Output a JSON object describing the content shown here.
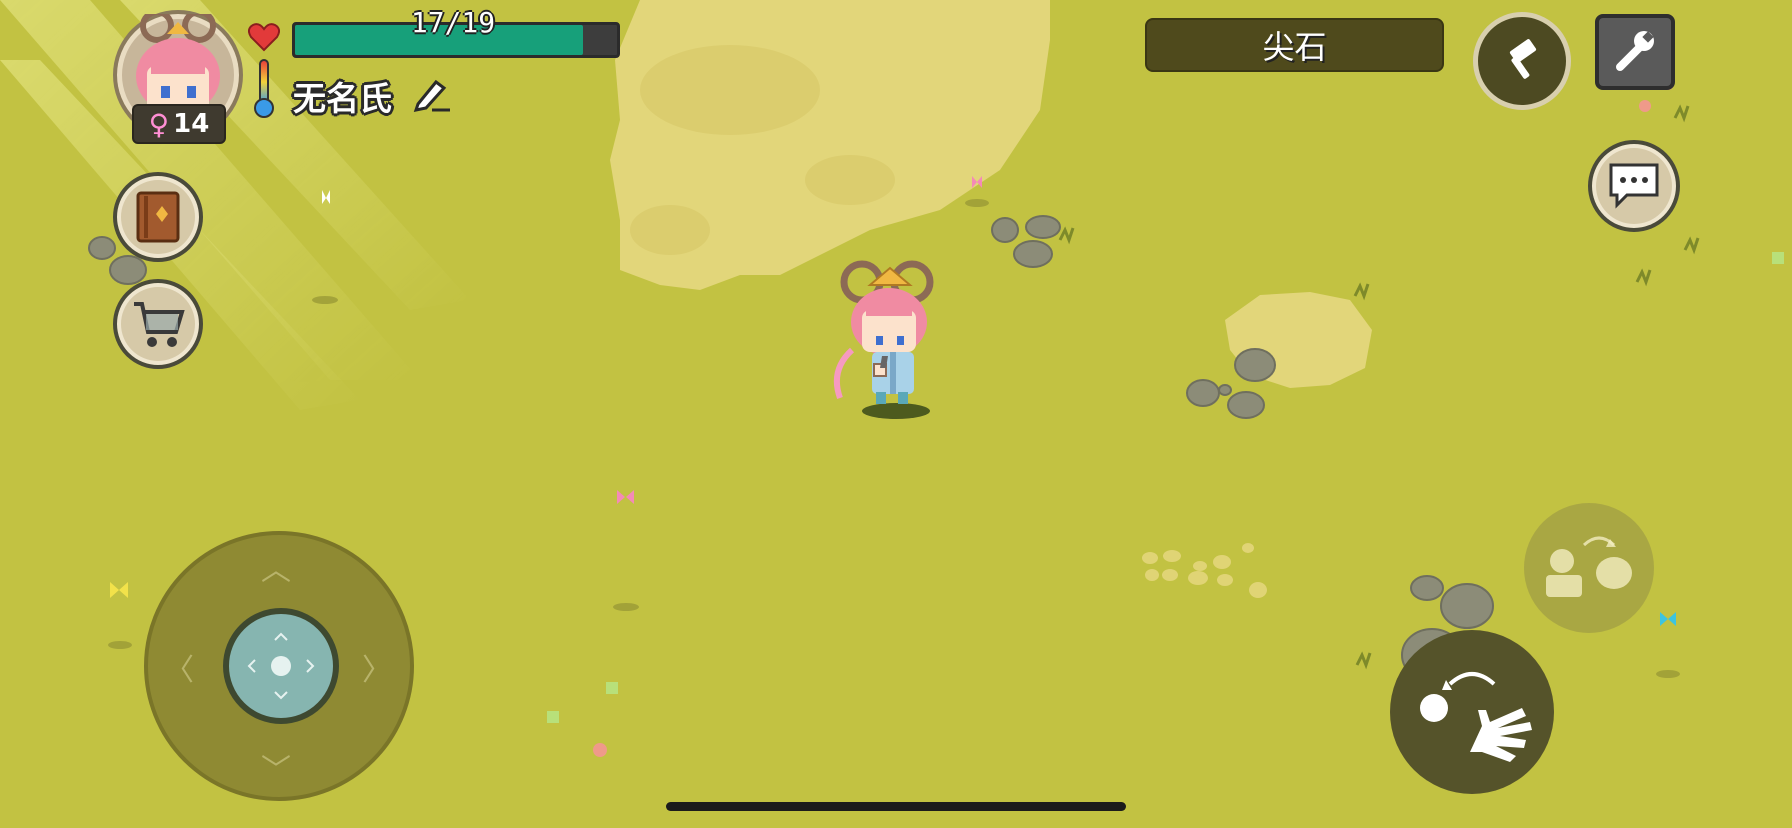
{
  "player": {
    "level": "14",
    "gender_icon": "female-icon",
    "name": "无名氏",
    "health_text": "17/19",
    "health_fraction": 0.894
  },
  "target": {
    "label": "尖石"
  },
  "colors": {
    "grass": "#c2c242",
    "health": "#17a07a",
    "sand": "#e2d67a",
    "stone": "#8c8c78"
  },
  "icons": {
    "heart": "heart-icon",
    "thermometer": "thermometer-icon",
    "edit": "pencil-icon",
    "book": "book-icon",
    "cart": "shopping-cart-icon",
    "hammer": "hammer-icon",
    "wrench": "wrench-icon",
    "chat": "chat-bubble-icon",
    "grab": "grab-icon",
    "interact": "hand-interact-icon"
  }
}
